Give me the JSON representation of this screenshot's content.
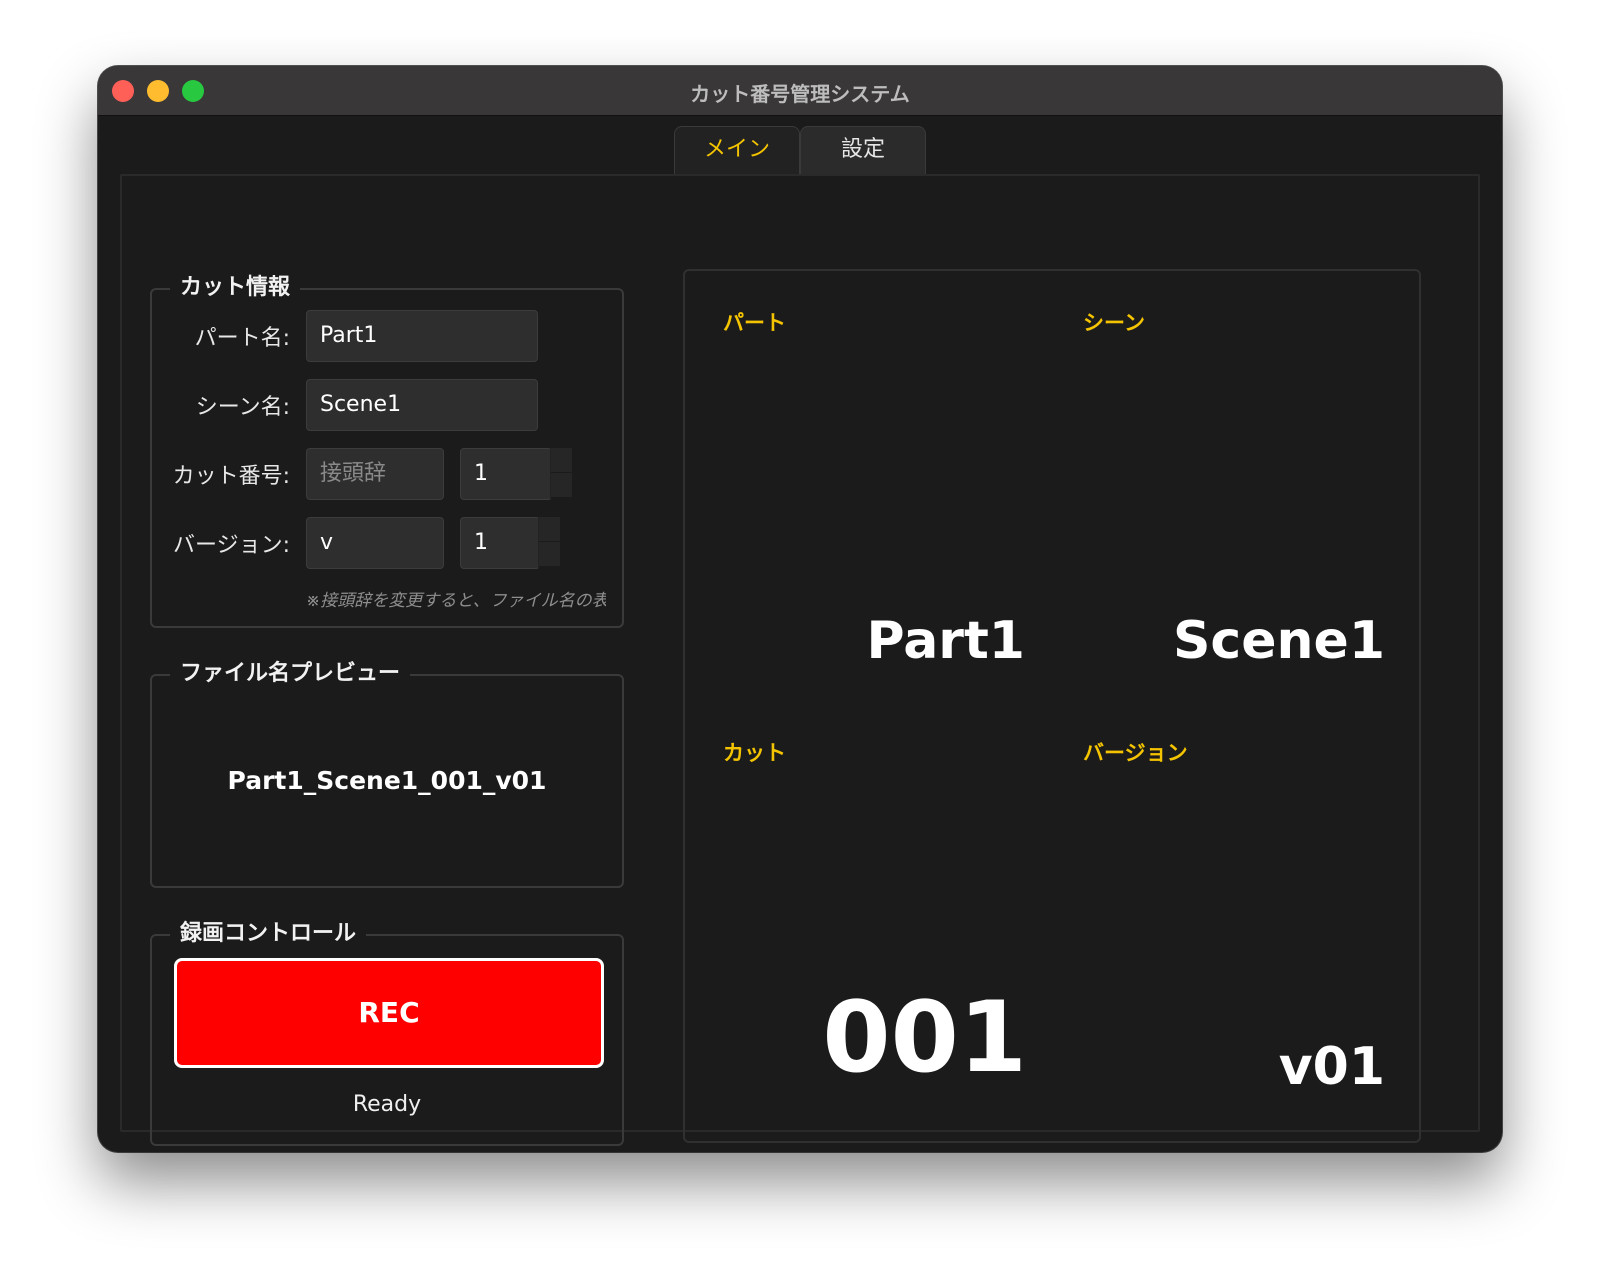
{
  "window": {
    "title": "カット番号管理システム"
  },
  "tabs": [
    {
      "label": "メイン",
      "active": true
    },
    {
      "label": "設定",
      "active": false
    }
  ],
  "cut_info": {
    "title": "カット情報",
    "part_label": "パート名:",
    "part_value": "Part1",
    "scene_label": "シーン名:",
    "scene_value": "Scene1",
    "cut_label": "カット番号:",
    "cut_prefix_placeholder": "接頭辞",
    "cut_number": "1",
    "version_label": "バージョン:",
    "version_prefix": "v",
    "version_number": "1",
    "note": "※接頭辞を変更すると、ファイル名の表"
  },
  "preview": {
    "title": "ファイル名プレビュー",
    "filename": "Part1_Scene1_001_v01"
  },
  "recording": {
    "title": "録画コントロール",
    "button_label": "REC",
    "status": "Ready"
  },
  "display": {
    "part_label": "パート",
    "part_value": "Part1",
    "scene_label": "シーン",
    "scene_value": "Scene1",
    "cut_label": "カット",
    "cut_value": "001",
    "version_label": "バージョン",
    "version_value": "v01"
  },
  "colors": {
    "accent": "#f5c400",
    "rec": "#ff0000",
    "background": "#1b1b1b"
  }
}
